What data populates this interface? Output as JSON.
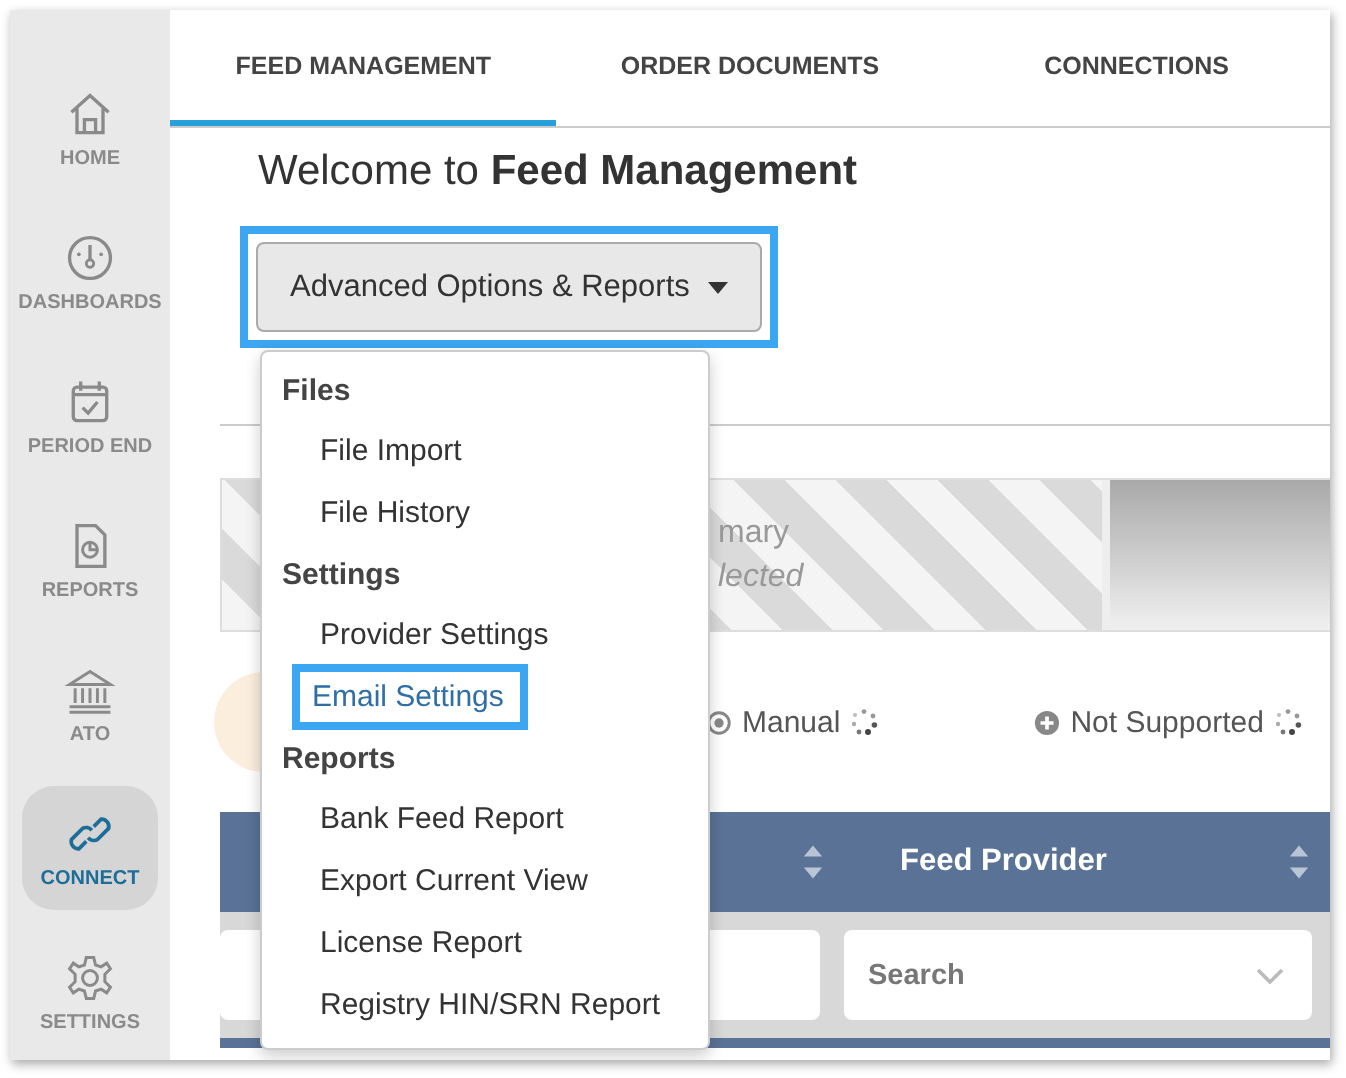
{
  "sidebar": {
    "items": [
      {
        "label": "HOME",
        "kind": "home",
        "selected": false
      },
      {
        "label": "DASHBOARDS",
        "kind": "gauge",
        "selected": false
      },
      {
        "label": "PERIOD END",
        "kind": "calendar",
        "selected": false
      },
      {
        "label": "REPORTS",
        "kind": "report",
        "selected": false
      },
      {
        "label": "ATO",
        "kind": "bank",
        "selected": false
      },
      {
        "label": "CONNECT",
        "kind": "link",
        "selected": true
      },
      {
        "label": "SETTINGS",
        "kind": "gear",
        "selected": false
      }
    ]
  },
  "tabs": [
    {
      "label": "FEED MANAGEMENT",
      "selected": true
    },
    {
      "label": "ORDER DOCUMENTS",
      "selected": false
    },
    {
      "label": "CONNECTIONS",
      "selected": false
    }
  ],
  "heading": "Welcome to **Feed Management**",
  "options_button": {
    "label": "Advanced Options & Reports",
    "highlighted": true
  },
  "menu": {
    "sections": [
      {
        "title": "Files",
        "items": [
          {
            "label": "File Import",
            "highlighted": false
          },
          {
            "label": "File History",
            "highlighted": false
          }
        ]
      },
      {
        "title": "Settings",
        "items": [
          {
            "label": "Provider Settings",
            "highlighted": false
          },
          {
            "label": "Email Settings",
            "highlighted": true
          }
        ]
      },
      {
        "title": "Reports",
        "items": [
          {
            "label": "Bank Feed Report",
            "highlighted": false
          },
          {
            "label": "Export Current View",
            "highlighted": false
          },
          {
            "label": "License Report",
            "highlighted": false
          },
          {
            "label": "Registry HIN/SRN Report",
            "highlighted": false
          }
        ]
      }
    ]
  },
  "summary_banner": {
    "title": "mary",
    "subtitle": "lected"
  },
  "legend": [
    {
      "kind": "manual",
      "label": "Manual"
    },
    {
      "kind": "unsupported",
      "label": "Not Supported"
    }
  ],
  "table": {
    "columns": [
      {
        "sortable": true
      },
      {
        "label": "Feed Provider",
        "sortable": true
      }
    ],
    "filters": [
      {
        "kind": "text"
      },
      {
        "kind": "select",
        "placeholder": "Search"
      }
    ]
  }
}
